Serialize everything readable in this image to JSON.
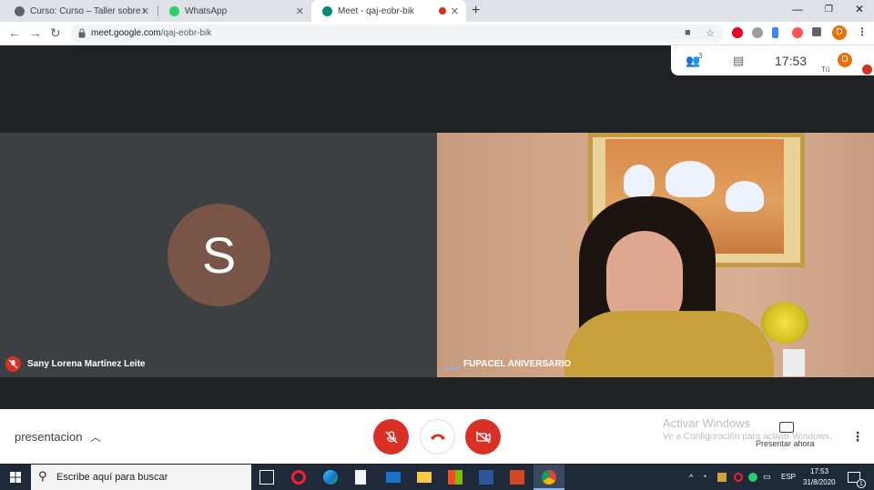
{
  "browser": {
    "tabs": [
      {
        "title": "Curso: Curso – Taller sobre Celiac",
        "active": false
      },
      {
        "title": "WhatsApp",
        "active": false
      },
      {
        "title": "Meet - qaj-eobr-bik",
        "active": true
      }
    ],
    "new_tab_symbol": "+",
    "url_host": "meet.google.com",
    "url_path": "/qaj-eobr-bik",
    "profile_initial": "D"
  },
  "meet": {
    "participants_count": "3",
    "time": "17:53",
    "self_label": "Tú",
    "tiles": [
      {
        "name": "Sany Lorena Martínez Leite",
        "avatar_letter": "S",
        "muted": true
      },
      {
        "name": "FUPACEL ANIVERSARIO",
        "video": true
      }
    ],
    "meeting_name": "presentacion",
    "controls": {
      "mic": "muted",
      "camera": "off"
    },
    "present_now": "Presentar ahora",
    "activation_title": "Activar Windows",
    "activation_sub": "Ve a Configuración para activar Windows."
  },
  "taskbar": {
    "search_placeholder": "Escribe aquí para buscar",
    "lang": "ESP",
    "clock_time": "17:53",
    "clock_date": "31/8/2020",
    "notification_count": "1"
  },
  "colors": {
    "meet_bg": "#202124",
    "tile_bg": "#3c4043",
    "avatar": "#795548",
    "red": "#d93025",
    "taskbar": "#1e2a3a"
  }
}
